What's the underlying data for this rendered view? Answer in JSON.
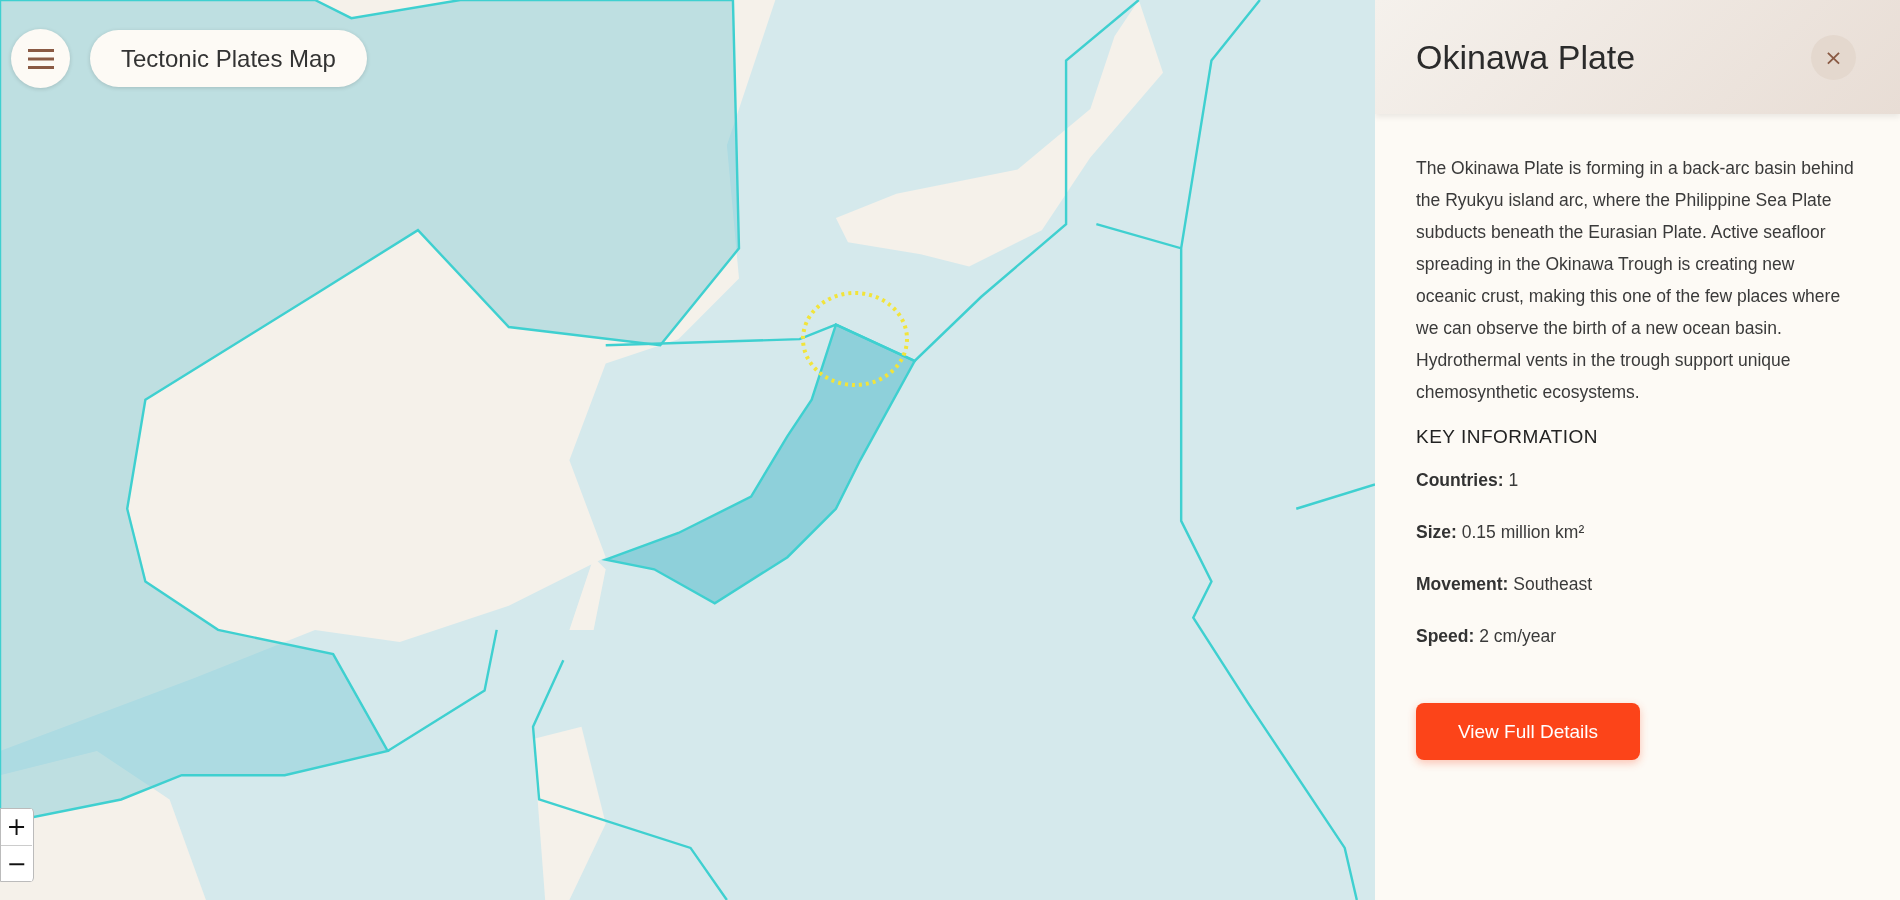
{
  "header": {
    "title": "Tectonic Plates Map"
  },
  "map_controls": {
    "zoom_in": "+",
    "zoom_out": "−"
  },
  "panel": {
    "title": "Okinawa Plate",
    "close": "×",
    "description": "The Okinawa Plate is forming in a back-arc basin behind the Ryukyu island arc, where the Philippine Sea Plate subducts beneath the Eurasian Plate. Active seafloor spreading in the Okinawa Trough is creating new oceanic crust, making this one of the few places where we can observe the birth of a new ocean basin. Hydrothermal vents in the trough support unique chemosynthetic ecosystems.",
    "section_heading": "KEY INFORMATION",
    "facts": [
      {
        "label": "Countries:",
        "value": "1"
      },
      {
        "label": "Size:",
        "value": "0.15 million km²"
      },
      {
        "label": "Movement:",
        "value": "Southeast"
      },
      {
        "label": "Speed:",
        "value": "2 cm/year"
      }
    ],
    "button": "View Full Details"
  }
}
